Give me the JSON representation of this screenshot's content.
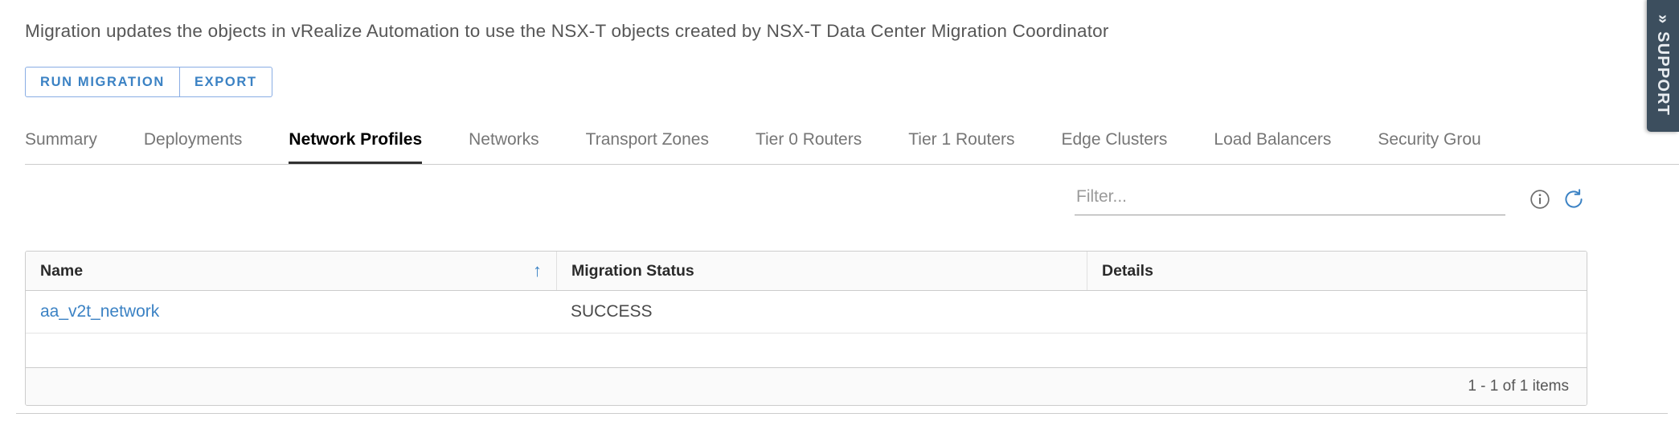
{
  "description": "Migration updates the objects in vRealize Automation to use the NSX-T objects created by NSX-T Data Center Migration Coordinator",
  "actions": {
    "run_migration_label": "RUN MIGRATION",
    "export_label": "EXPORT"
  },
  "tabs": [
    {
      "label": "Summary",
      "active": false
    },
    {
      "label": "Deployments",
      "active": false
    },
    {
      "label": "Network Profiles",
      "active": true
    },
    {
      "label": "Networks",
      "active": false
    },
    {
      "label": "Transport Zones",
      "active": false
    },
    {
      "label": "Tier 0 Routers",
      "active": false
    },
    {
      "label": "Tier 1 Routers",
      "active": false
    },
    {
      "label": "Edge Clusters",
      "active": false
    },
    {
      "label": "Load Balancers",
      "active": false
    },
    {
      "label": "Security Grou",
      "active": false
    }
  ],
  "filter": {
    "placeholder": "Filter...",
    "value": "",
    "info_icon": "info-circle-icon",
    "refresh_icon": "refresh-icon"
  },
  "grid": {
    "columns": [
      {
        "label": "Name",
        "sorted": true,
        "sort_direction": "ascending",
        "sort_glyph": "↑"
      },
      {
        "label": "Migration Status",
        "sorted": false
      },
      {
        "label": "Details",
        "sorted": false
      }
    ],
    "rows": [
      {
        "name": "aa_v2t_network",
        "status": "SUCCESS",
        "details": ""
      }
    ],
    "footer_text": "1 - 1 of 1 items"
  },
  "support": {
    "label": "SUPPORT",
    "chevron": "«"
  },
  "colors": {
    "link": "#3b82c4",
    "button_border": "#89ade4",
    "active_tab_underline": "#313131",
    "support_background": "#3c4e5e",
    "grid_border": "#cccccc"
  }
}
